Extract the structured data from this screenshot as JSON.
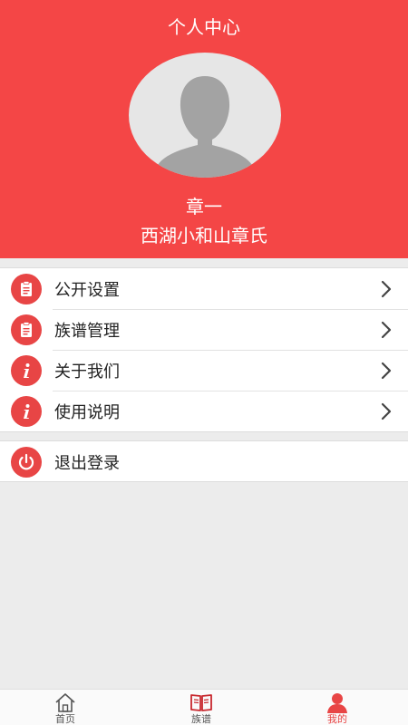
{
  "header": {
    "title": "个人中心",
    "user_name": "章一",
    "clan_name": "西湖小和山章氏"
  },
  "menu": {
    "items": [
      {
        "label": "公开设置",
        "icon": "document-icon"
      },
      {
        "label": "族谱管理",
        "icon": "document-icon"
      },
      {
        "label": "关于我们",
        "icon": "info-icon"
      },
      {
        "label": "使用说明",
        "icon": "info-icon"
      }
    ],
    "logout": {
      "label": "退出登录",
      "icon": "power-icon"
    }
  },
  "tabbar": {
    "tabs": [
      {
        "label": "首页",
        "icon": "home-icon"
      },
      {
        "label": "族谱",
        "icon": "book-icon"
      },
      {
        "label": "我的",
        "icon": "user-icon",
        "active": true
      }
    ]
  },
  "colors": {
    "header_bg": "#f44646",
    "accent": "#e84545",
    "page_bg": "#ececec"
  }
}
